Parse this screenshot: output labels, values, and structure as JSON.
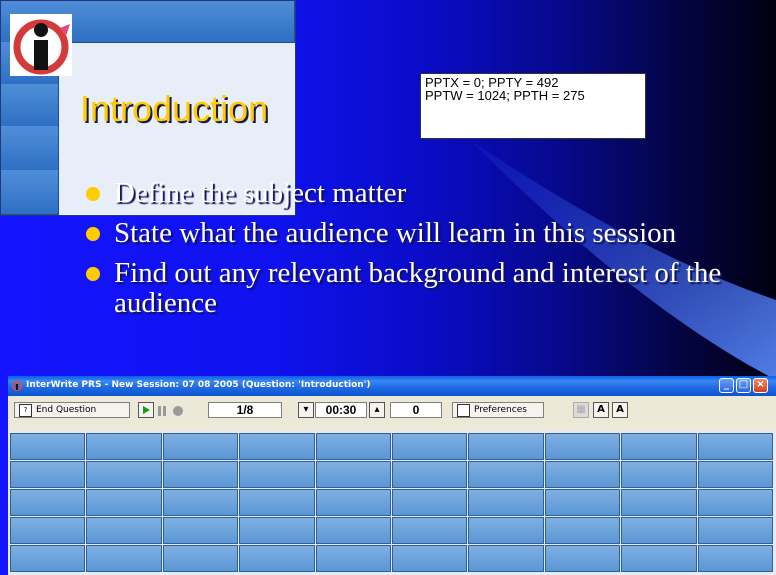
{
  "slide": {
    "title": "Introduction",
    "info_lines": [
      "PPTX = 0; PPTY = 492",
      "PPTW = 1024; PPTH = 275"
    ],
    "bullets": [
      "Define the subject matter",
      "State what the audience will learn in this session",
      "Find out any relevant background and interest of the audience"
    ],
    "colors": {
      "title": "#ffcc00",
      "bullet_dot": "#ffcc00",
      "background": "#1414ff"
    }
  },
  "prs_window": {
    "title": "InterWrite PRS - New Session: 07 08 2005 (Question: 'Introduction')",
    "titlebar_buttons": [
      "minimize-icon",
      "maximize-icon",
      "close-icon"
    ],
    "toolbar": {
      "end_question_label": "End Question",
      "question_counter": "1/8",
      "timer": "00:30",
      "response_count": "0",
      "preferences_label": "Preferences"
    },
    "grid": {
      "rows": 5,
      "columns": 10
    }
  }
}
